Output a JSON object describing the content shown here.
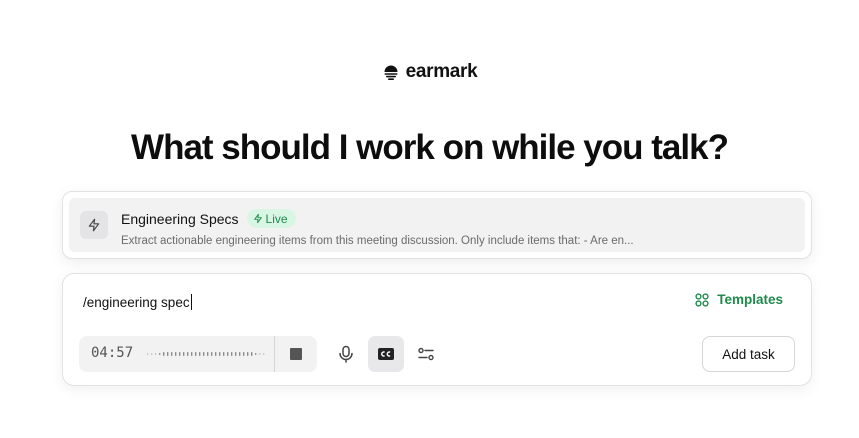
{
  "brand": {
    "name": "earmark",
    "logo_icon": "earmark-logo-icon"
  },
  "headline": "What should I work on while you talk?",
  "suggestion": {
    "title": "Engineering Specs",
    "badge": "Live",
    "description": "Extract actionable engineering items from this meeting discussion. Only include items that: - Are en...",
    "icon": "bolt-icon"
  },
  "composer": {
    "input_value": "/engineering spec",
    "templates_label": "Templates",
    "timer": "04:57",
    "add_task_label": "Add task"
  },
  "colors": {
    "accent_green": "#1f8a4c",
    "badge_bg": "#d9f6e5",
    "panel_gray": "#f2f2f3"
  }
}
